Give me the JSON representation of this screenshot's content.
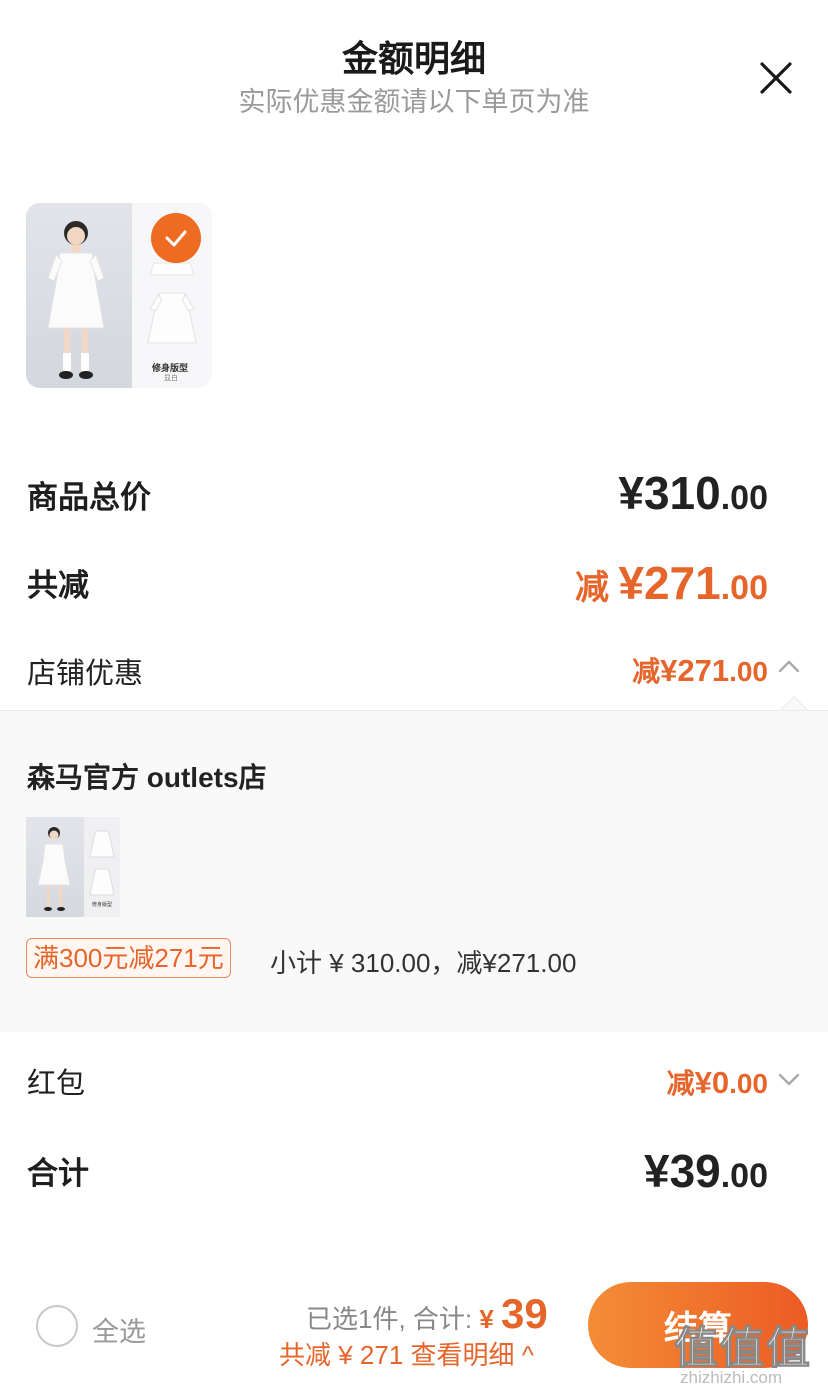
{
  "header": {
    "title": "金额明细",
    "subtitle": "实际优惠金额请以下单页为准"
  },
  "product": {
    "label": "修身版型",
    "sub": "显白",
    "selected": true
  },
  "summary": {
    "total_label": "商品总价",
    "total_int": "¥310",
    "total_cents": ".00",
    "reduce_label": "共减",
    "reduce_prefix": "减 ",
    "reduce_int": "¥271",
    "reduce_cents": ".00",
    "store_discount_label": "店铺优惠",
    "store_discount_prefix": "减",
    "store_discount_int": "¥271",
    "store_discount_cents": ".00"
  },
  "store_detail": {
    "store_name": "森马官方 outlets店",
    "mini_label": "修身版型",
    "promo_tag": "满300元减271元",
    "subtotal": "小计 ¥ 310.00，减¥271.00"
  },
  "red_packet": {
    "label": "红包",
    "prefix": "减",
    "int": "¥0",
    "cents": ".00"
  },
  "grand_total": {
    "label": "合计",
    "int": "¥39",
    "cents": ".00"
  },
  "bottom_bar": {
    "select_all": "全选",
    "selected_text": "已选1件, 合计: ",
    "currency": "¥ ",
    "amount": "39",
    "discount_link": "共减 ¥ 271 查看明细 ^",
    "checkout": "结算"
  },
  "watermark": {
    "top": "值值值",
    "bottom": "zhizhizhi.com"
  },
  "colors": {
    "accent": "#e5652a",
    "checkout_start": "#f48d37",
    "checkout_end": "#ec5b23"
  }
}
